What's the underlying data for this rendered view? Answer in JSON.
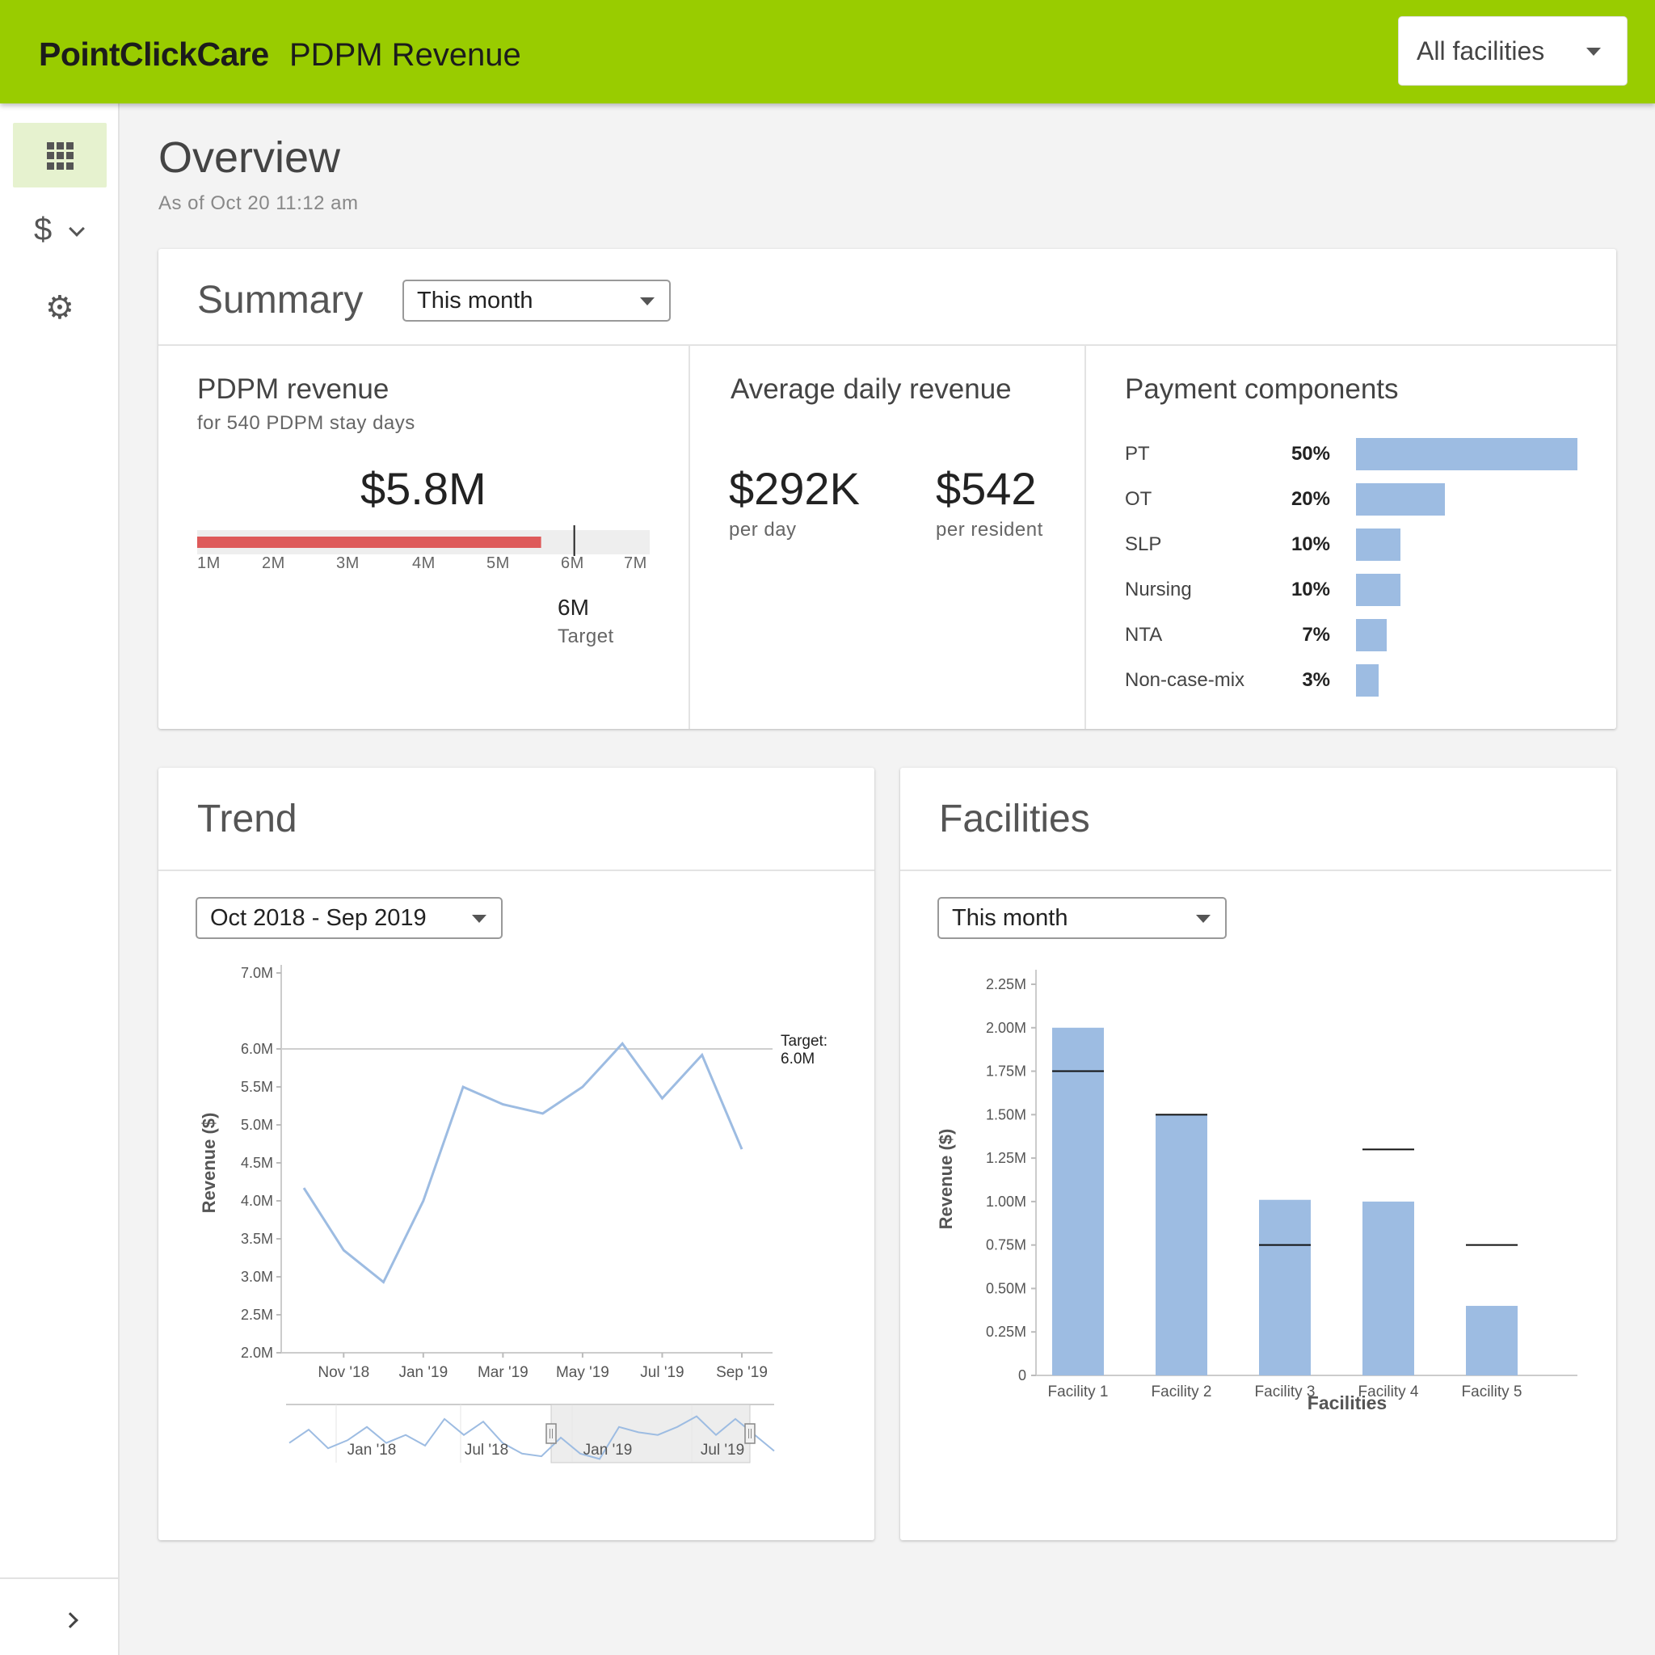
{
  "header": {
    "brand": "PointClickCare",
    "title": "PDPM Revenue",
    "facility_selector": "All facilities"
  },
  "sidebar": {
    "items": [
      {
        "name": "dashboard",
        "icon": "grid-icon"
      },
      {
        "name": "revenue",
        "icon": "dollar-icon",
        "glyph": "$"
      },
      {
        "name": "settings",
        "icon": "gear-icon",
        "glyph": "⚙"
      }
    ]
  },
  "page": {
    "title": "Overview",
    "subtitle": "As of Oct 20 11:12 am"
  },
  "summary": {
    "title": "Summary",
    "period": "This month",
    "pdpm_revenue": {
      "heading": "PDPM revenue",
      "sub": "for 540 PDPM stay days",
      "value": "$5.8M",
      "bar_value_millions": 5.8,
      "target_label": "6M",
      "target_caption": "Target",
      "axis": [
        "1M",
        "2M",
        "3M",
        "4M",
        "5M",
        "6M",
        "7M"
      ]
    },
    "avg_daily": {
      "heading": "Average daily revenue",
      "per_day_value": "$292K",
      "per_day_label": "per day",
      "per_resident_value": "$542",
      "per_resident_label": "per resident"
    },
    "payment_components": {
      "heading": "Payment components",
      "rows": [
        {
          "label": "PT",
          "pct": "50%",
          "value": 50
        },
        {
          "label": "OT",
          "pct": "20%",
          "value": 20
        },
        {
          "label": "SLP",
          "pct": "10%",
          "value": 10
        },
        {
          "label": "Nursing",
          "pct": "10%",
          "value": 10
        },
        {
          "label": "NTA",
          "pct": "7%",
          "value": 7
        },
        {
          "label": "Non-case-mix",
          "pct": "3%",
          "value": 3
        }
      ]
    }
  },
  "trend": {
    "title": "Trend",
    "range": "Oct 2018 - Sep 2019"
  },
  "facilities": {
    "title": "Facilities",
    "period": "This month"
  },
  "colors": {
    "brand": "#99cc00",
    "bar": "#9dbce2",
    "progress": "#de5a5a"
  },
  "chart_data": [
    {
      "type": "line",
      "id": "trend",
      "ylabel": "Revenue ($)",
      "x": [
        "Oct '18",
        "Nov '18",
        "Dec '18",
        "Jan '19",
        "Feb '19",
        "Mar '19",
        "Apr '19",
        "May '19",
        "Jun '19",
        "Jul '19",
        "Aug '19",
        "Sep '19"
      ],
      "values": [
        4.17,
        3.35,
        2.93,
        4.0,
        5.5,
        5.27,
        5.15,
        5.5,
        6.07,
        5.35,
        5.92,
        4.68
      ],
      "x_tick_labels": [
        "Nov '18",
        "Jan '19",
        "Mar '19",
        "May '19",
        "Jul '19",
        "Sep '19"
      ],
      "y_tick_labels": [
        "7.0M",
        "6.0M",
        "5.5M",
        "5.0M",
        "4.5M",
        "4.0M",
        "3.5M",
        "3.0M",
        "2.5M",
        "2.0M"
      ],
      "y_ticks": [
        7.0,
        6.0,
        5.5,
        5.0,
        4.5,
        4.0,
        3.5,
        3.0,
        2.5,
        2.0
      ],
      "ylim": [
        2.0,
        7.0
      ],
      "target": 6.0,
      "target_label_line1": "Target:",
      "target_label_line2": "6.0M",
      "navigator": {
        "labels": [
          "Jan '18",
          "Jul '18",
          "Jan '19",
          "Jul '19"
        ],
        "values": [
          4.0,
          4.5,
          3.8,
          4.1,
          4.6,
          4.0,
          4.3,
          3.9,
          4.9,
          4.3,
          4.8,
          4.0,
          3.6,
          3.5,
          4.2,
          3.6,
          3.4,
          4.6,
          4.4,
          4.3,
          4.6,
          5.0,
          4.3,
          4.9,
          4.3,
          3.7
        ]
      }
    },
    {
      "type": "bar",
      "id": "facilities",
      "xlabel": "Facilities",
      "ylabel": "Revenue ($)",
      "categories": [
        "Facility 1",
        "Facility 2",
        "Facility 3",
        "Facility 4",
        "Facility 5"
      ],
      "values": [
        2.0,
        1.5,
        1.01,
        1.0,
        0.4
      ],
      "targets": [
        1.75,
        1.5,
        0.75,
        1.3,
        0.75
      ],
      "y_ticks": [
        0,
        0.25,
        0.5,
        0.75,
        1.0,
        1.25,
        1.5,
        1.75,
        2.0,
        2.25
      ],
      "y_tick_labels": [
        "0",
        "0.25M",
        "0.50M",
        "0.75M",
        "1.00M",
        "1.25M",
        "1.50M",
        "1.75M",
        "2.00M",
        "2.25M"
      ],
      "ylim": [
        0,
        2.25
      ]
    }
  ]
}
